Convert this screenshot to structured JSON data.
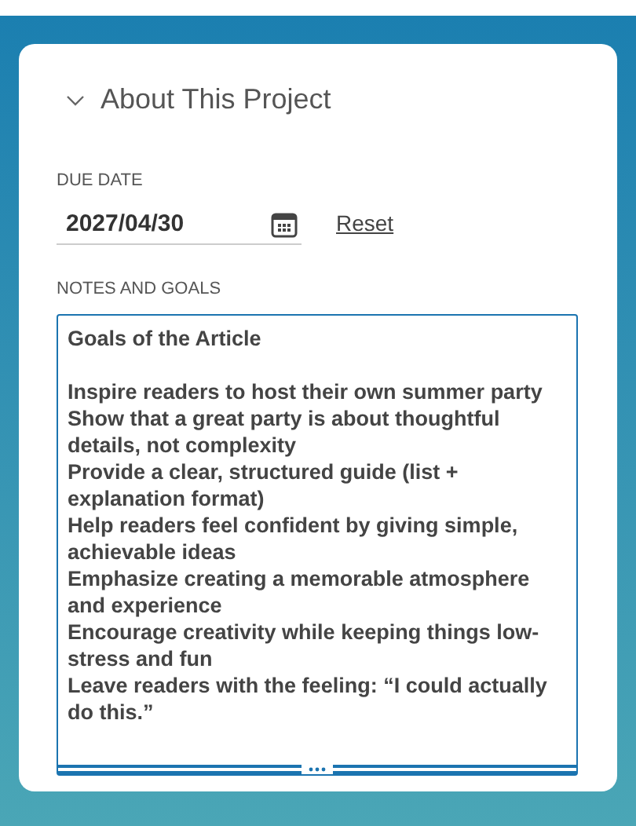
{
  "section": {
    "title": "About This Project",
    "expanded": true
  },
  "due_date": {
    "label": "DUE DATE",
    "value": "2027/04/30",
    "reset_link": "Reset"
  },
  "notes": {
    "label": "NOTES AND GOALS",
    "value": "Goals of the Article\n\nInspire readers to host their own summer party\nShow that a great party is about thoughtful details, not complexity\nProvide a clear, structured guide (list + explanation format)\nHelp readers feel confident by giving simple, achievable ideas\nEmphasize creating a memorable atmosphere and experience\nEncourage creativity while keeping things low-stress and fun\nLeave readers with the feeling: “I could actually do this.”"
  }
}
